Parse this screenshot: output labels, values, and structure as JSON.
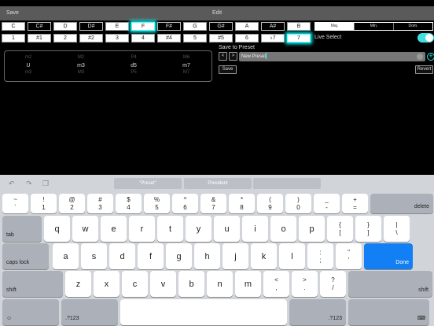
{
  "topbar": {
    "left": "Save",
    "right": "Edit"
  },
  "notes": [
    "C",
    "C#",
    "D",
    "D#",
    "E",
    "F",
    "F#",
    "G",
    "G#",
    "A",
    "A#",
    "B"
  ],
  "degrees": [
    "1",
    "#1",
    "2",
    "#2",
    "3",
    "4",
    "#4",
    "5",
    "#5",
    "6",
    "♭7",
    "7"
  ],
  "selected_note": "F",
  "selected_degree": "7",
  "chord_types": [
    "Maj.",
    "Min.",
    "Dom."
  ],
  "selected_chord_type": "Maj.",
  "live_select": {
    "label": "Live Select",
    "on": true
  },
  "preset": {
    "label": "Save to Preset",
    "prev": "<",
    "next": ">",
    "value": "New Preset",
    "save": "Save",
    "revert": "Revert",
    "add": "+"
  },
  "intervals": [
    [
      "m2",
      "U",
      "m3"
    ],
    [
      "M2",
      "m3",
      "M3"
    ],
    [
      "P4",
      "d5",
      "P5"
    ],
    [
      "M6",
      "m7",
      "M7"
    ]
  ],
  "keyboard": {
    "suggestions": [
      "\"Preset\"",
      "President",
      ""
    ],
    "rows": [
      [
        [
          "~",
          "`"
        ],
        [
          "!",
          "1"
        ],
        [
          "@",
          "2"
        ],
        [
          "#",
          "3"
        ],
        [
          "$",
          "4"
        ],
        [
          "%",
          "5"
        ],
        [
          "^",
          "6"
        ],
        [
          "&",
          "7"
        ],
        [
          "*",
          "8"
        ],
        [
          "(",
          "9"
        ],
        [
          ")",
          "0"
        ],
        [
          "_",
          "-"
        ],
        [
          "+",
          "="
        ],
        [
          "delete"
        ]
      ],
      [
        [
          "tab"
        ],
        [
          "q"
        ],
        [
          "w"
        ],
        [
          "e"
        ],
        [
          "r"
        ],
        [
          "t"
        ],
        [
          "y"
        ],
        [
          "u"
        ],
        [
          "i"
        ],
        [
          "o"
        ],
        [
          "p"
        ],
        [
          "{",
          "["
        ],
        [
          "}",
          "]"
        ],
        [
          "|",
          "\\"
        ]
      ],
      [
        [
          "caps lock"
        ],
        [
          "a"
        ],
        [
          "s"
        ],
        [
          "d"
        ],
        [
          "f"
        ],
        [
          "g"
        ],
        [
          "h"
        ],
        [
          "j"
        ],
        [
          "k"
        ],
        [
          "l"
        ],
        [
          ":",
          ";"
        ],
        [
          "\"",
          "'"
        ],
        [
          "Done"
        ]
      ],
      [
        [
          "shift"
        ],
        [
          "z"
        ],
        [
          "x"
        ],
        [
          "c"
        ],
        [
          "v"
        ],
        [
          "b"
        ],
        [
          "n"
        ],
        [
          "m"
        ],
        [
          "<",
          ","
        ],
        [
          ">",
          "."
        ],
        [
          "?",
          "/"
        ],
        [
          "shift"
        ]
      ],
      [
        [
          "☺"
        ],
        [
          ".?123"
        ],
        [
          ""
        ],
        [
          ".?123"
        ],
        [
          "⌨"
        ]
      ]
    ]
  }
}
